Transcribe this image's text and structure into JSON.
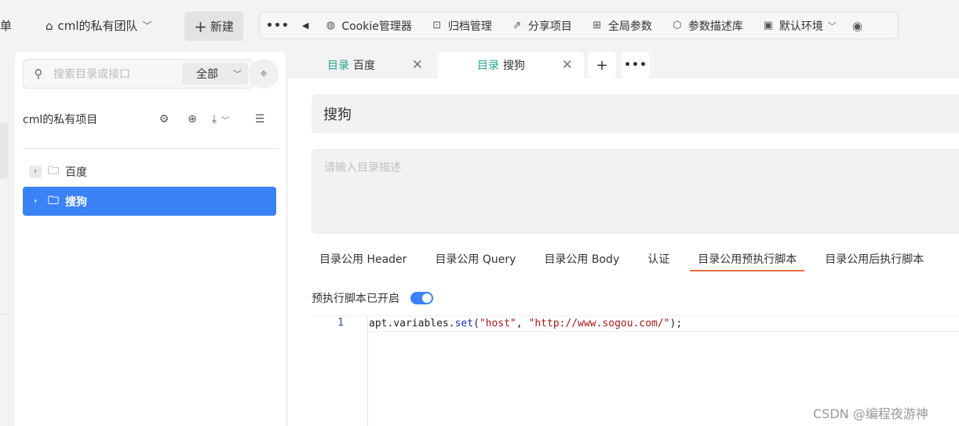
{
  "topbar": {
    "menu_cut": "单",
    "team": "cml的私有团队",
    "new_button": "新建",
    "toolbar": {
      "more": "•••",
      "back": "◀",
      "items": [
        {
          "label": "Cookie管理器",
          "icon": "cookie-icon"
        },
        {
          "label": "归档管理",
          "icon": "archive-icon"
        },
        {
          "label": "分享项目",
          "icon": "share-icon"
        },
        {
          "label": "全局参数",
          "icon": "params-icon"
        },
        {
          "label": "参数描述库",
          "icon": "cube-icon"
        },
        {
          "label": "默认环境",
          "icon": "env-icon"
        }
      ]
    }
  },
  "sidebar": {
    "search_placeholder": "搜索目录或接口",
    "scope": "全部",
    "project": "cml的私有项目",
    "tree": [
      {
        "label": "百度",
        "active": false
      },
      {
        "label": "搜狗",
        "active": true
      }
    ]
  },
  "tabs": [
    {
      "kind": "目录",
      "label": "百度",
      "active": false
    },
    {
      "kind": "目录",
      "label": "搜狗",
      "active": true
    }
  ],
  "main": {
    "name": "搜狗",
    "desc_placeholder": "请输入目录描述",
    "subtabs": [
      "目录公用 Header",
      "目录公用 Query",
      "目录公用 Body",
      "认证",
      "目录公用预执行脚本",
      "目录公用后执行脚本"
    ],
    "active_subtab": "目录公用预执行脚本",
    "toggle_label": "预执行脚本已开启",
    "toggle_on": true,
    "editor": {
      "line_number": "1",
      "code_prefix": "apt.variables.",
      "code_fn": "set",
      "code_open": "(",
      "code_arg1": "\"host\"",
      "code_sep": ", ",
      "code_arg2": "\"http://www.sogou.com/\"",
      "code_close": ");"
    }
  },
  "watermark": "CSDN @编程夜游神",
  "colors": {
    "accent": "#3b82f6",
    "tab_kind": "#22a38d",
    "subtab_underline": "#e8693a"
  }
}
